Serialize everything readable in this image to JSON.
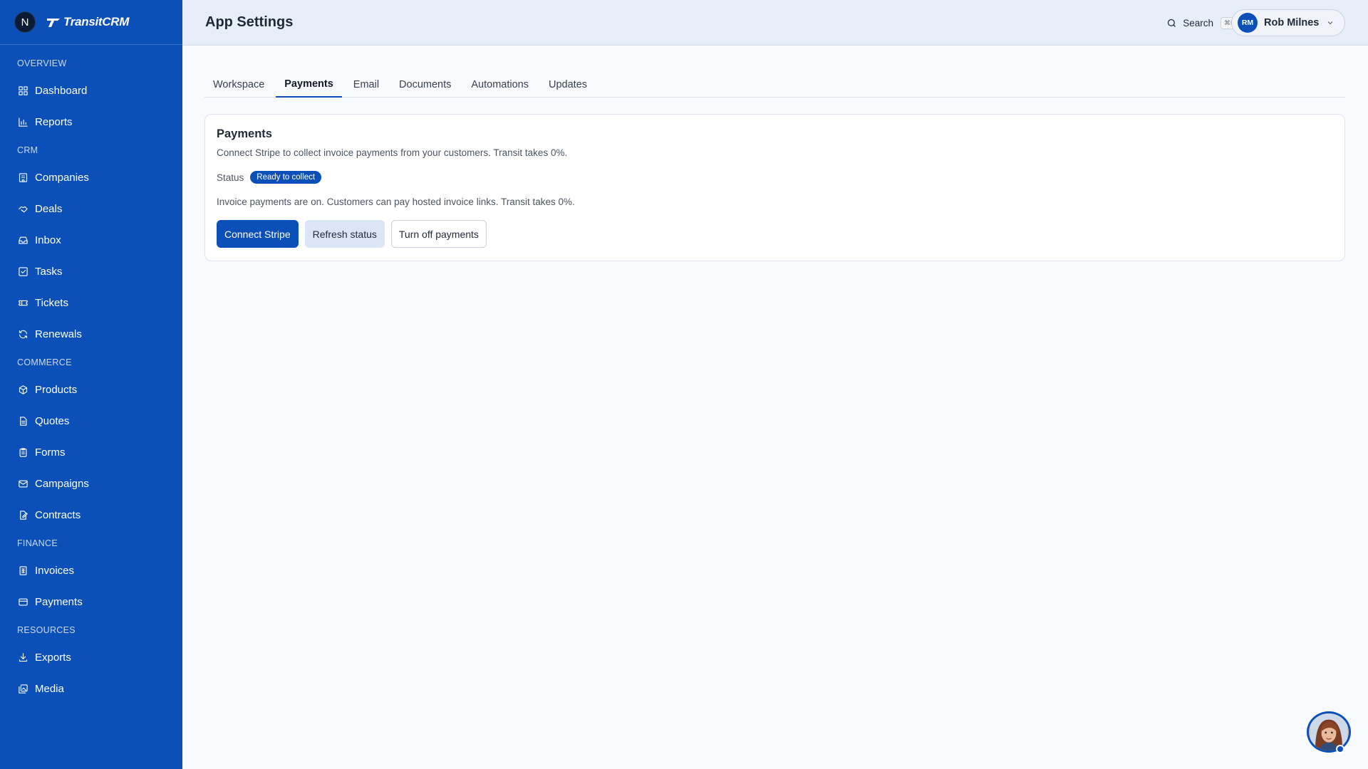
{
  "brand": {
    "workspace_initial": "N",
    "app_name": "TransitCRM"
  },
  "sidebar": {
    "sections": [
      {
        "title": "OVERVIEW",
        "items": [
          {
            "label": "Dashboard",
            "icon": "dashboard-icon"
          },
          {
            "label": "Reports",
            "icon": "bar-chart-icon"
          }
        ]
      },
      {
        "title": "CRM",
        "items": [
          {
            "label": "Companies",
            "icon": "building-icon"
          },
          {
            "label": "Deals",
            "icon": "handshake-icon"
          },
          {
            "label": "Inbox",
            "icon": "inbox-icon"
          },
          {
            "label": "Tasks",
            "icon": "checkbox-icon"
          },
          {
            "label": "Tickets",
            "icon": "ticket-icon"
          },
          {
            "label": "Renewals",
            "icon": "refresh-icon"
          }
        ]
      },
      {
        "title": "COMMERCE",
        "items": [
          {
            "label": "Products",
            "icon": "box-icon"
          },
          {
            "label": "Quotes",
            "icon": "document-icon"
          },
          {
            "label": "Forms",
            "icon": "clipboard-icon"
          },
          {
            "label": "Campaigns",
            "icon": "mail-icon"
          },
          {
            "label": "Contracts",
            "icon": "file-signature-icon"
          }
        ]
      },
      {
        "title": "FINANCE",
        "items": [
          {
            "label": "Invoices",
            "icon": "invoice-icon"
          },
          {
            "label": "Payments",
            "icon": "credit-card-icon"
          }
        ]
      },
      {
        "title": "RESOURCES",
        "items": [
          {
            "label": "Exports",
            "icon": "download-icon"
          },
          {
            "label": "Media",
            "icon": "images-icon"
          }
        ]
      }
    ]
  },
  "header": {
    "title": "App Settings",
    "search_label": "Search",
    "search_shortcut": "⌘K",
    "user": {
      "initials": "RM",
      "name": "Rob Milnes"
    }
  },
  "tabs": [
    {
      "label": "Workspace",
      "active": false
    },
    {
      "label": "Payments",
      "active": true
    },
    {
      "label": "Email",
      "active": false
    },
    {
      "label": "Documents",
      "active": false
    },
    {
      "label": "Automations",
      "active": false
    },
    {
      "label": "Updates",
      "active": false
    }
  ],
  "payments_card": {
    "title": "Payments",
    "description": "Connect Stripe to collect invoice payments from your customers. Transit takes 0%.",
    "status_label": "Status",
    "status_badge": "Ready to collect",
    "note": "Invoice payments are on. Customers can pay hosted invoice links. Transit takes 0%.",
    "buttons": {
      "connect": "Connect Stripe",
      "refresh": "Refresh status",
      "turn_off": "Turn off payments"
    }
  },
  "colors": {
    "accent": "#0b50b8",
    "header_bg": "#e7eef8",
    "page_bg": "#f8fafd"
  }
}
